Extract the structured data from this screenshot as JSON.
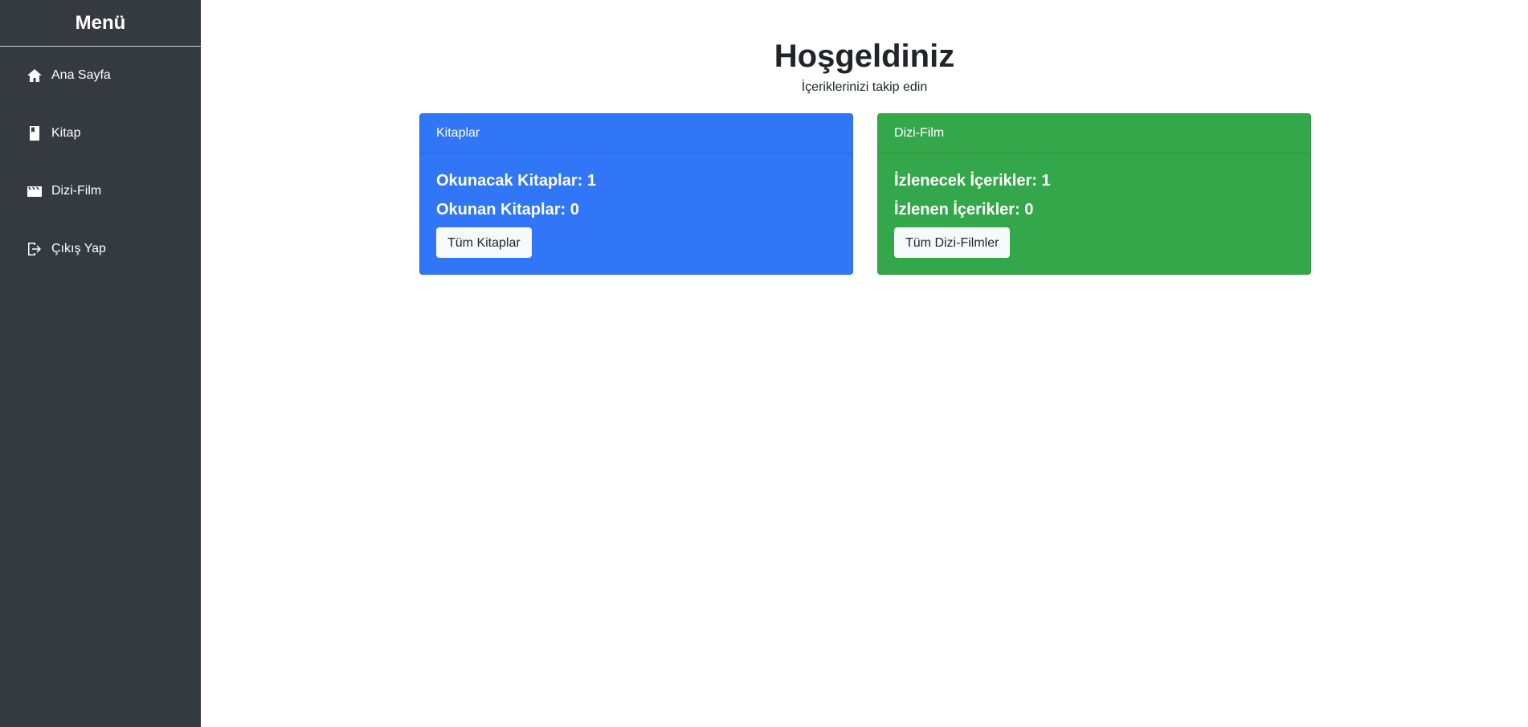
{
  "sidebar": {
    "title": "Menü",
    "items": [
      {
        "label": "Ana Sayfa",
        "icon": "home-icon"
      },
      {
        "label": "Kitap",
        "icon": "book-icon"
      },
      {
        "label": "Dizi-Film",
        "icon": "film-icon"
      },
      {
        "label": "Çıkış Yap",
        "icon": "logout-icon"
      }
    ]
  },
  "main": {
    "title": "Hoşgeldiniz",
    "subtitle": "İçeriklerinizi takip edin"
  },
  "cards": [
    {
      "header": "Kitaplar",
      "line1": "Okunacak Kitaplar: 1",
      "line2": "Okunan Kitaplar: 0",
      "button": "Tüm Kitaplar",
      "color": "#3076f6"
    },
    {
      "header": "Dizi-Film",
      "line1": "İzlenecek İçerikler: 1",
      "line2": "İzlenen İçerikler: 0",
      "button": "Tüm Dizi-Filmler",
      "color": "#35a74b"
    }
  ],
  "colors": {
    "sidebar_bg": "#343a40",
    "text_dark": "#212529",
    "button_bg": "#f8f9fa"
  }
}
